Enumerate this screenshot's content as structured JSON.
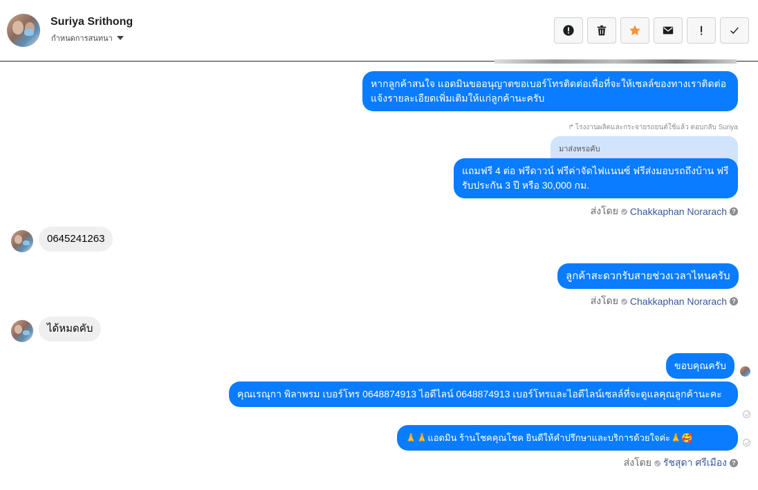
{
  "header": {
    "contact_name": "Suriya Srithong",
    "subtitle": "กำหนดการสนทนา",
    "actions": [
      {
        "name": "mark-spam",
        "icon": "alert-circle-icon"
      },
      {
        "name": "delete",
        "icon": "trash-icon"
      },
      {
        "name": "star",
        "icon": "star-icon"
      },
      {
        "name": "mark-unread",
        "icon": "envelope-icon"
      },
      {
        "name": "follow-up",
        "icon": "exclamation-icon"
      },
      {
        "name": "mark-done",
        "icon": "checkmark-icon"
      }
    ],
    "star_color": "#f7923b"
  },
  "messages": {
    "m1": "หากลูกค้าสนใจ แอดมินขออนุญาตขอเบอร์โทรติดต่อเพื่อที่จะให้เซลล์ของทางเราติดต่อแจ้งรายละเอียดเพิ่มเติมให้แก่ลูกค้านะครับ",
    "reply_note": "โรงงานผลิตและกระจายรถยนต์ใช้แล้ว ตอบกลับ Suriya",
    "quoted": "มาส่งหรอคับ",
    "m2": "แถมฟรี 4 ต่อ ฟรีดาวน์ ฟรีค่าจัดไฟแนนซ์ ฟรีส่งมอบรถถึงบ้าน ฟรีรับประกัน 3 ปี หรือ 30,000 กม.",
    "sent_by_label": "ส่งโดย",
    "sender_1": "Chakkaphan Norarach",
    "in1": "0645241263",
    "m3": "ลูกค้าสะดวกรับสายช่วงเวลาไหนครับ",
    "in2": "ได้หมดคับ",
    "m4": "ขอบคุณครับ",
    "m5": "คุณเรณุกา พิลาพรม        เบอร์โทร 0648874913  ไอดีไลน์ 0648874913  เบอร์โทรและไอดีไลน์เซลล์ที่จะดูแลคุณลูกค้านะคะ",
    "m6": "🙏🙏แอดมิน ร้านโชคคุณโชค ยินดีให้คำปรึกษาและบริการด้วยใจค่ะ🙏🥰",
    "sender_2": "รัชสุดา ศรีเมือง"
  },
  "colors": {
    "outgoing": "#0a7cff",
    "incoming": "#efefef"
  }
}
